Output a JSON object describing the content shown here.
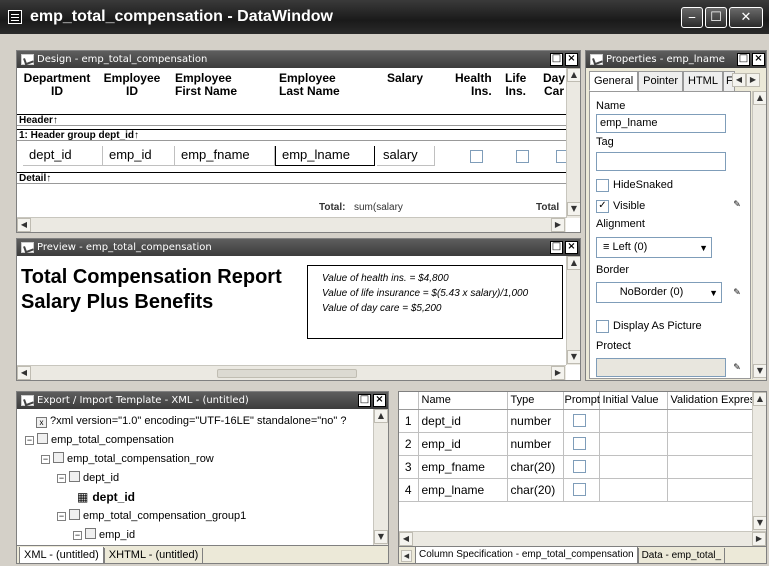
{
  "window": {
    "title": "emp_total_compensation  - DataWindow"
  },
  "design": {
    "title": "Design - emp_total_compensation",
    "headers": [
      {
        "line1": "Department",
        "line2": "ID"
      },
      {
        "line1": "Employee",
        "line2": "ID"
      },
      {
        "line1": "Employee",
        "line2": "First Name"
      },
      {
        "line1": "Employee",
        "line2": "Last Name"
      },
      {
        "line1": "Salary",
        "line2": ""
      },
      {
        "line1": "Health",
        "line2": "Ins."
      },
      {
        "line1": "Life",
        "line2": "Ins."
      },
      {
        "line1": "Day",
        "line2": "Car"
      }
    ],
    "band_header": "Header↑",
    "band_group": "1: Header group dept_id↑",
    "band_detail": "Detail↑",
    "fields": [
      "dept_id",
      "emp_id",
      "emp_fname",
      "emp_lname",
      "salary"
    ],
    "total_label": "Total:",
    "sum_expr": "sum(salary",
    "total_label2": "Total"
  },
  "preview": {
    "title": "Preview - emp_total_compensation",
    "heading1": "Total Compensation Report",
    "heading2": "Salary Plus Benefits",
    "note1": "Value of health ins. = $4,800",
    "note2": "Value of life insurance = $(5.43 x salary)/1,000",
    "note3": "Value of day care = $5,200"
  },
  "properties": {
    "title": "Properties - emp_lname",
    "tabs": [
      "General",
      "Pointer",
      "HTML",
      "F"
    ],
    "name_label": "Name",
    "name_value": "emp_lname",
    "tag_label": "Tag",
    "tag_value": "",
    "hidesnaked_label": "HideSnaked",
    "hidesnaked_checked": false,
    "visible_label": "Visible",
    "visible_checked": true,
    "alignment_label": "Alignment",
    "alignment_value": "Left (0)",
    "border_label": "Border",
    "border_value": "NoBorder (0)",
    "display_picture_label": "Display As Picture",
    "display_picture_checked": false,
    "protect_label": "Protect",
    "protect_value": ""
  },
  "export": {
    "title": "Export / Import Template - XML - (untitled)",
    "tree": [
      {
        "text": "?xml version=\"1.0\" encoding=\"UTF-16LE\" standalone=\"no\" ?"
      },
      {
        "text": "emp_total_compensation"
      },
      {
        "text": "emp_total_compensation_row"
      },
      {
        "text": "dept_id"
      },
      {
        "text": "dept_id"
      },
      {
        "text": "emp_total_compensation_group1"
      },
      {
        "text": "emp_id"
      }
    ],
    "tab_xml": "XML - (untitled)",
    "tab_xhtml": "XHTML - (untitled)"
  },
  "columns": {
    "headers": [
      "Name",
      "Type",
      "Prompt",
      "Initial Value",
      "Validation Expres"
    ],
    "rows": [
      {
        "num": "1",
        "name": "dept_id",
        "type": "number"
      },
      {
        "num": "2",
        "name": "emp_id",
        "type": "number"
      },
      {
        "num": "3",
        "name": "emp_fname",
        "type": "char(20)"
      },
      {
        "num": "4",
        "name": "emp_lname",
        "type": "char(20)"
      }
    ],
    "tab_colspec": "Column Specification - emp_total_compensation",
    "tab_data": "Data - emp_total_"
  },
  "colors": {
    "titlebar": "#2a2a2a",
    "pane_title": "#4a4a4a",
    "chrome": "#d4d0c8"
  }
}
